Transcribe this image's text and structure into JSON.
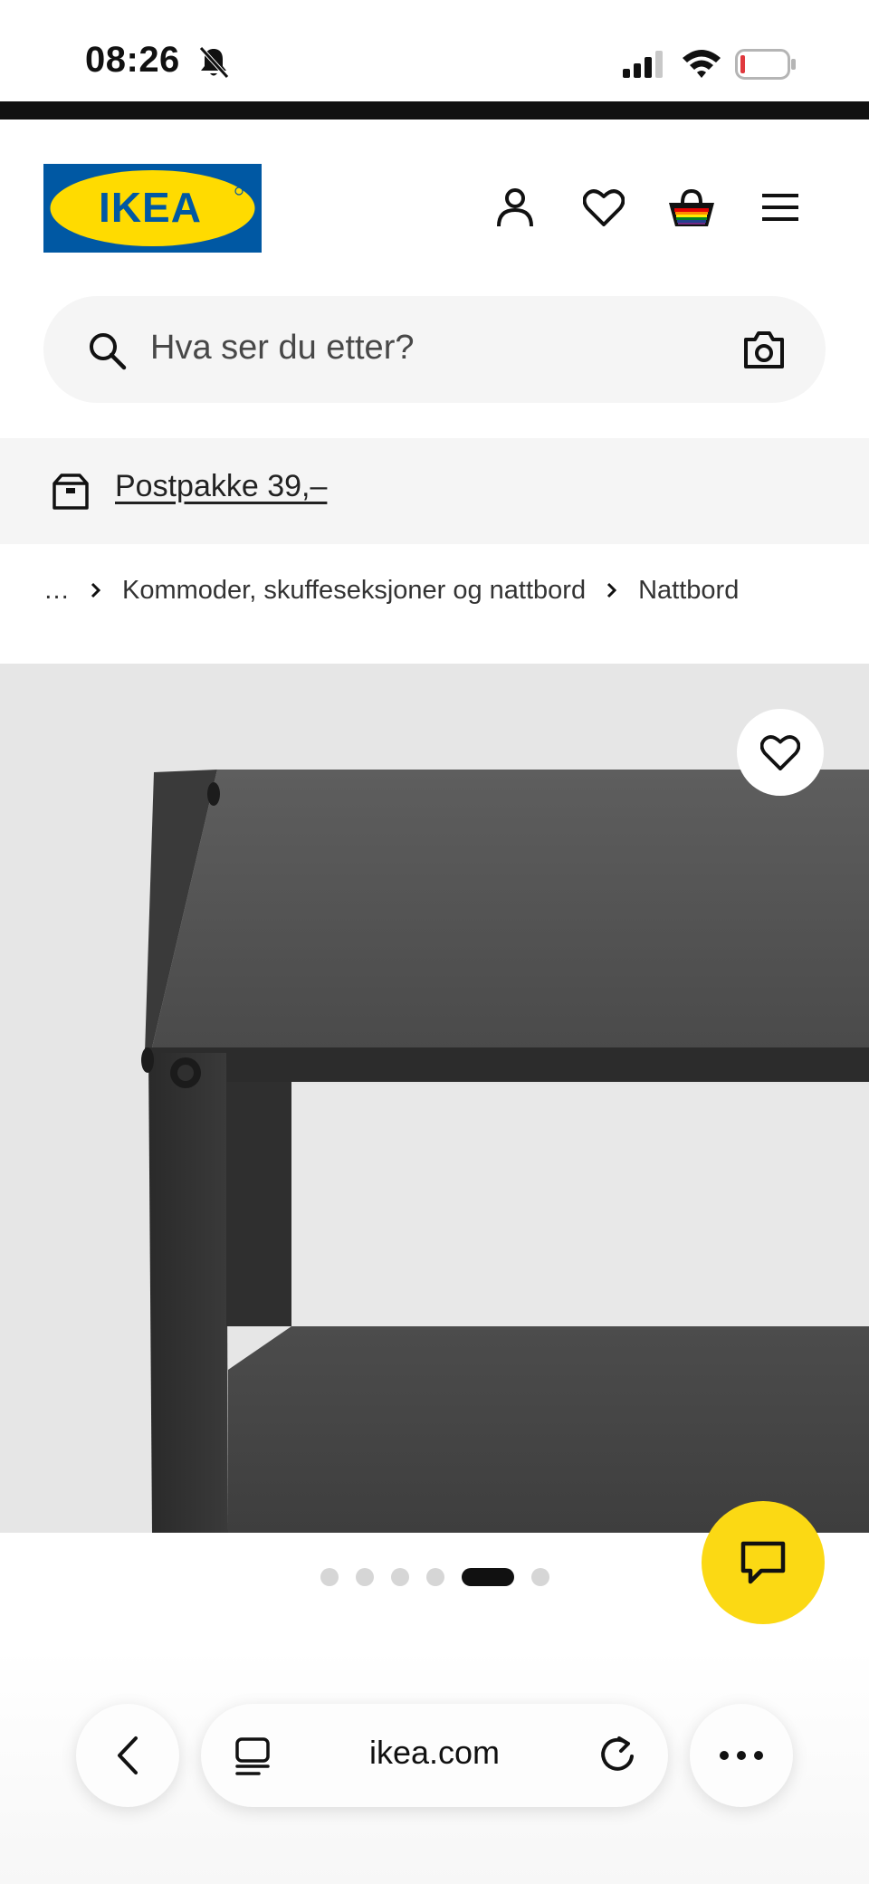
{
  "status_bar": {
    "time": "08:26",
    "icons": [
      "bell-muted-icon",
      "cellular-signal-icon",
      "wifi-icon",
      "battery-low-icon"
    ]
  },
  "header": {
    "logo_text": "IKEA",
    "logo_colors": {
      "background": "#0058a3",
      "oval": "#ffdb00",
      "text": "#0058a3"
    },
    "icons": [
      "account-icon",
      "favorites-icon",
      "basket-icon",
      "menu-icon"
    ]
  },
  "search": {
    "placeholder": "Hva ser du etter?",
    "icons": [
      "search-icon",
      "camera-icon"
    ]
  },
  "promo": {
    "link": "Postpakke 39,–",
    "icon": "parcel-box-icon"
  },
  "breadcrumb": {
    "items": [
      "…",
      "Kommoder, skuffeseksjoner og nattbord",
      "Nattbord"
    ]
  },
  "gallery": {
    "dot_count": 6,
    "active_index": 4,
    "favorite_icon": "heart-icon",
    "image": "black metal bedside table close-up"
  },
  "chat": {
    "icon": "chat-bubble-icon",
    "color": "#fbd914"
  },
  "browser": {
    "url": "ikea.com",
    "icons": [
      "back-icon",
      "tabs-icon",
      "reload-icon",
      "more-icon"
    ]
  }
}
